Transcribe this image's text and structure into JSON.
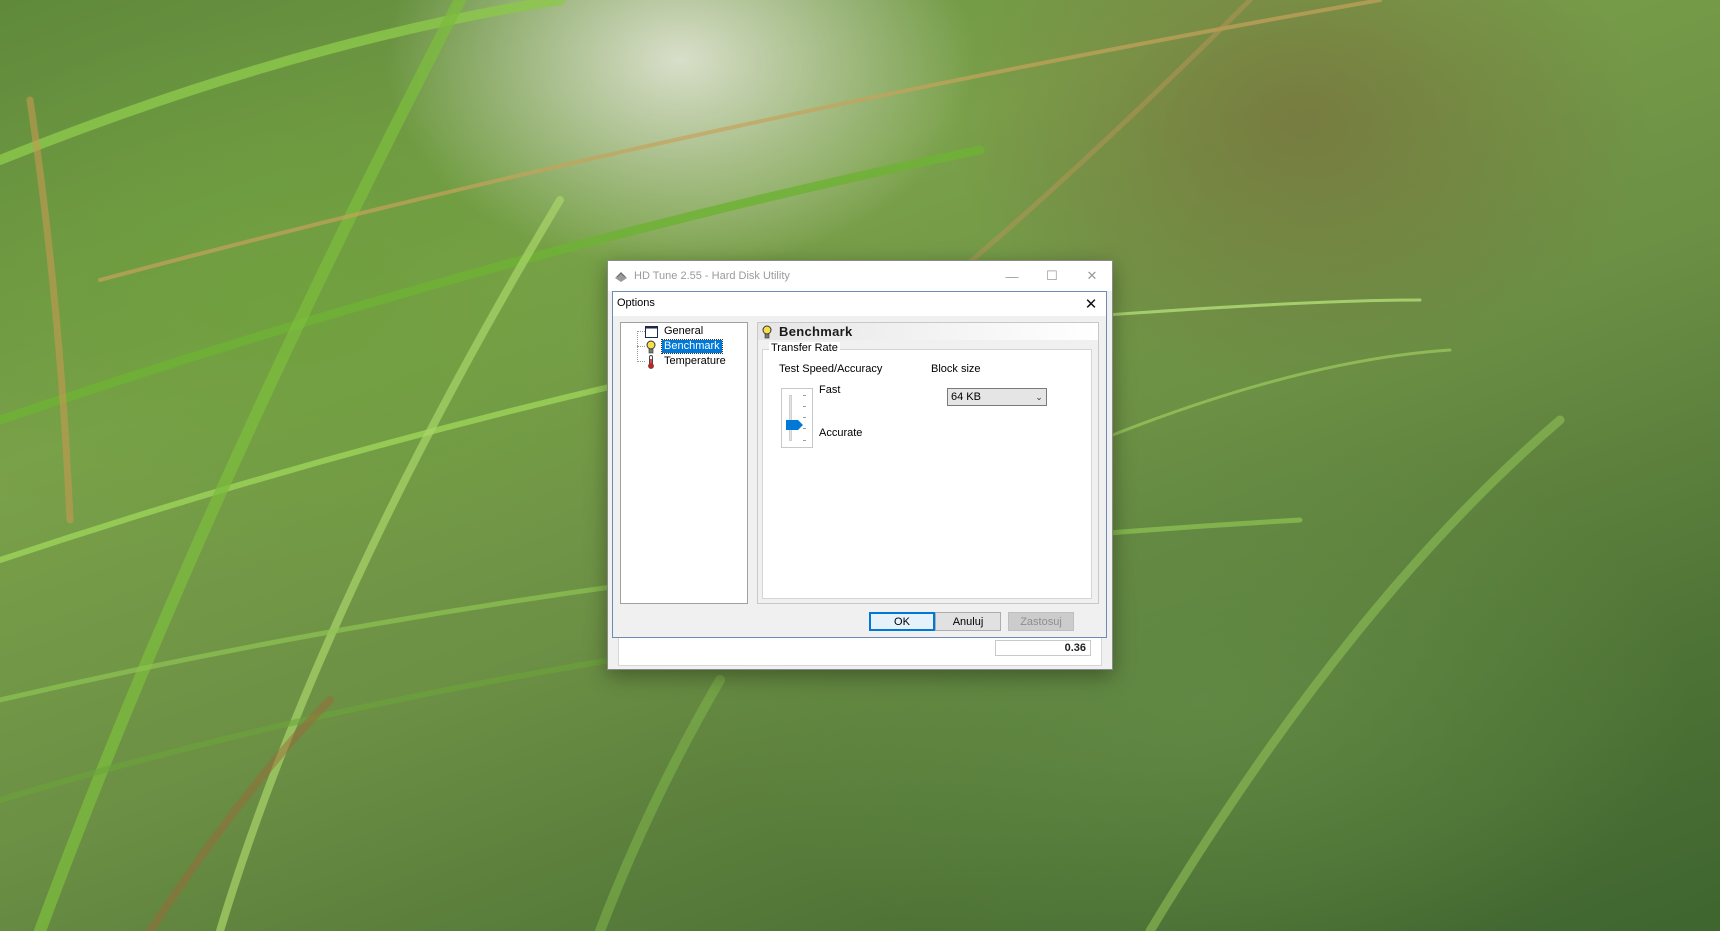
{
  "app_window": {
    "title": "HD Tune 2.55 - Hard Disk Utility",
    "value_partial": "0.36"
  },
  "dialog": {
    "title": "Options",
    "tree": {
      "items": [
        {
          "label": "General",
          "icon": "general-icon"
        },
        {
          "label": "Benchmark",
          "icon": "lightbulb-icon",
          "selected": true
        },
        {
          "label": "Temperature",
          "icon": "thermometer-icon"
        }
      ]
    },
    "panel": {
      "title": "Benchmark",
      "group_title": "Transfer Rate",
      "speed_label": "Test Speed/Accuracy",
      "fast_label": "Fast",
      "accurate_label": "Accurate",
      "block_size_label": "Block size",
      "block_size_value": "64 KB",
      "slider_level": "4 of 5 (toward Accurate)"
    },
    "buttons": {
      "ok": "OK",
      "cancel": "Anuluj",
      "apply": "Zastosuj"
    }
  },
  "colors": {
    "selection": "#0078d7",
    "dialog_border": "#6d8cb3"
  }
}
